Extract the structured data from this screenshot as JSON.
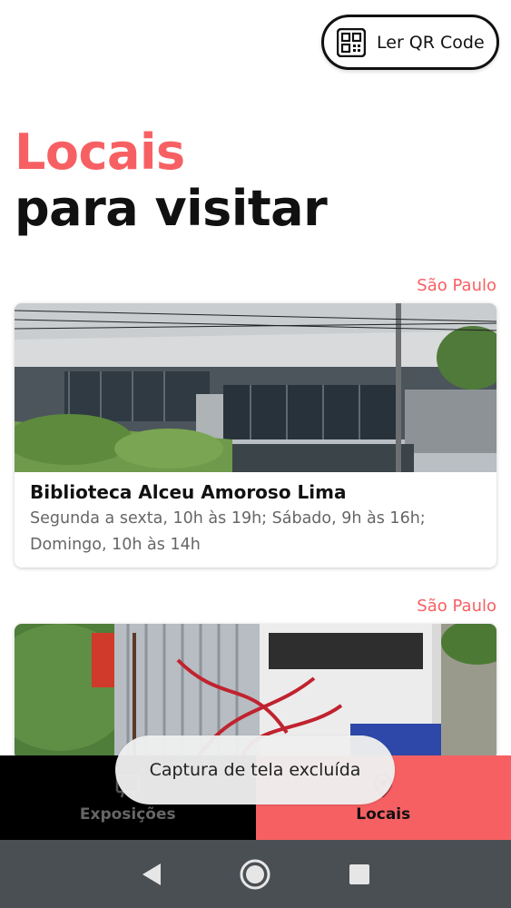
{
  "header": {
    "qr_button_label": "Ler QR Code",
    "qr_icon": "qr-code-icon"
  },
  "title": {
    "accent": "Locais",
    "main": "para visitar"
  },
  "places": [
    {
      "city": "São Paulo",
      "name": "Biblioteca Alceu Amoroso Lima",
      "hours": "Segunda a sexta, 10h às 19h; Sábado, 9h às 16h; Domingo, 10h às 14h"
    },
    {
      "city": "São Paulo"
    }
  ],
  "bottom_nav": {
    "tabs": [
      {
        "label": "Exposições",
        "icon": "exhibition-icon",
        "active": false
      },
      {
        "label": "Locais",
        "icon": "location-icon",
        "active": true
      }
    ]
  },
  "toast": {
    "message": "Captura de tela excluída"
  },
  "system_nav": {
    "buttons": [
      "back-icon",
      "home-icon",
      "recents-icon"
    ]
  },
  "colors": {
    "accent": "#F76063",
    "nav_dark": "#000000",
    "system_bar": "#4a4f54"
  }
}
